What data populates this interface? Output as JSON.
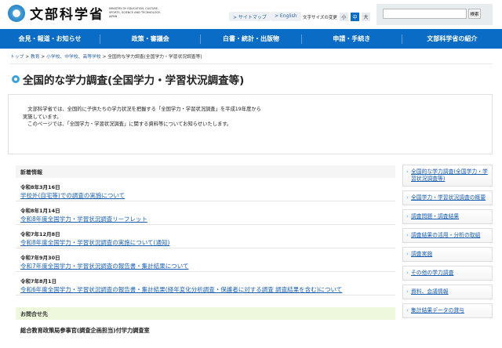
{
  "header": {
    "logo_jp": "文部科学省",
    "logo_en": "MINISTRY OF EDUCATION, CULTURE, SPORTS, SCIENCE AND TECHNOLOGY-JAPAN",
    "sitemap": "> サイトマップ",
    "english": "> English",
    "font_size_label": "文字サイズの変更",
    "font_small": "小",
    "font_medium": "中",
    "font_large": "大",
    "search_placeholder": "",
    "search_button": "検索"
  },
  "nav": [
    "会見・報道・お知らせ",
    "政策・審議会",
    "白書・統計・出版物",
    "申請・手続き",
    "文部科学省の紹介"
  ],
  "breadcrumb": {
    "items": [
      "トップ",
      "教育",
      "小学校、中学校、高等学校"
    ],
    "sep": " > ",
    "current": "全国的な学力調査(全国学力・学習状況調査等)"
  },
  "page_title": "全国的な学力調査(全国学力・学習状況調査等)",
  "intro": {
    "line1": "文部科学省では、全国的に子供たちの学力状況を把握する「全国学力・学習状況調査」を平成19年度から",
    "line2": "実施しています。",
    "line3": "このページでは、「全国学力・学習状況調査」に関する資料等についてお知らせいたします。"
  },
  "news": {
    "heading": "新着情報",
    "items": [
      {
        "date": "令和8年3月16日",
        "title": "学校外(自宅等)での調査の実施について"
      },
      {
        "date": "令和8年1月14日",
        "title": "令和8年度全国学力・学習状況調査リーフレット"
      },
      {
        "date": "令和7年12月8日",
        "title": "令和8年度全国学力・学習状況調査の実施について(通知)"
      },
      {
        "date": "令和7年9月30日",
        "title": "令和7年度全国学力・学習状況調査の報告書・集計結果について"
      },
      {
        "date": "令和7年8月1日",
        "title": "令和6年度全国学力・学習状況調査の報告書・集計結果(経年変化分析調査・保護者に対する調査 調査結果を含む)について"
      }
    ]
  },
  "contact": {
    "heading": "お問合せ先",
    "dept": "総合教育政策局参事官(調査企画担当)付学力調査室"
  },
  "sidebar": [
    "全国的な学力調査(全国学力・学習状況調査等)",
    "全国学力・学習状況調査の概要",
    "調査問題・調査結果",
    "調査結果の活用・分析の取組",
    "調査実施",
    "その他の学力調査",
    "資料、会議情報",
    "集計結果データの貸与"
  ]
}
